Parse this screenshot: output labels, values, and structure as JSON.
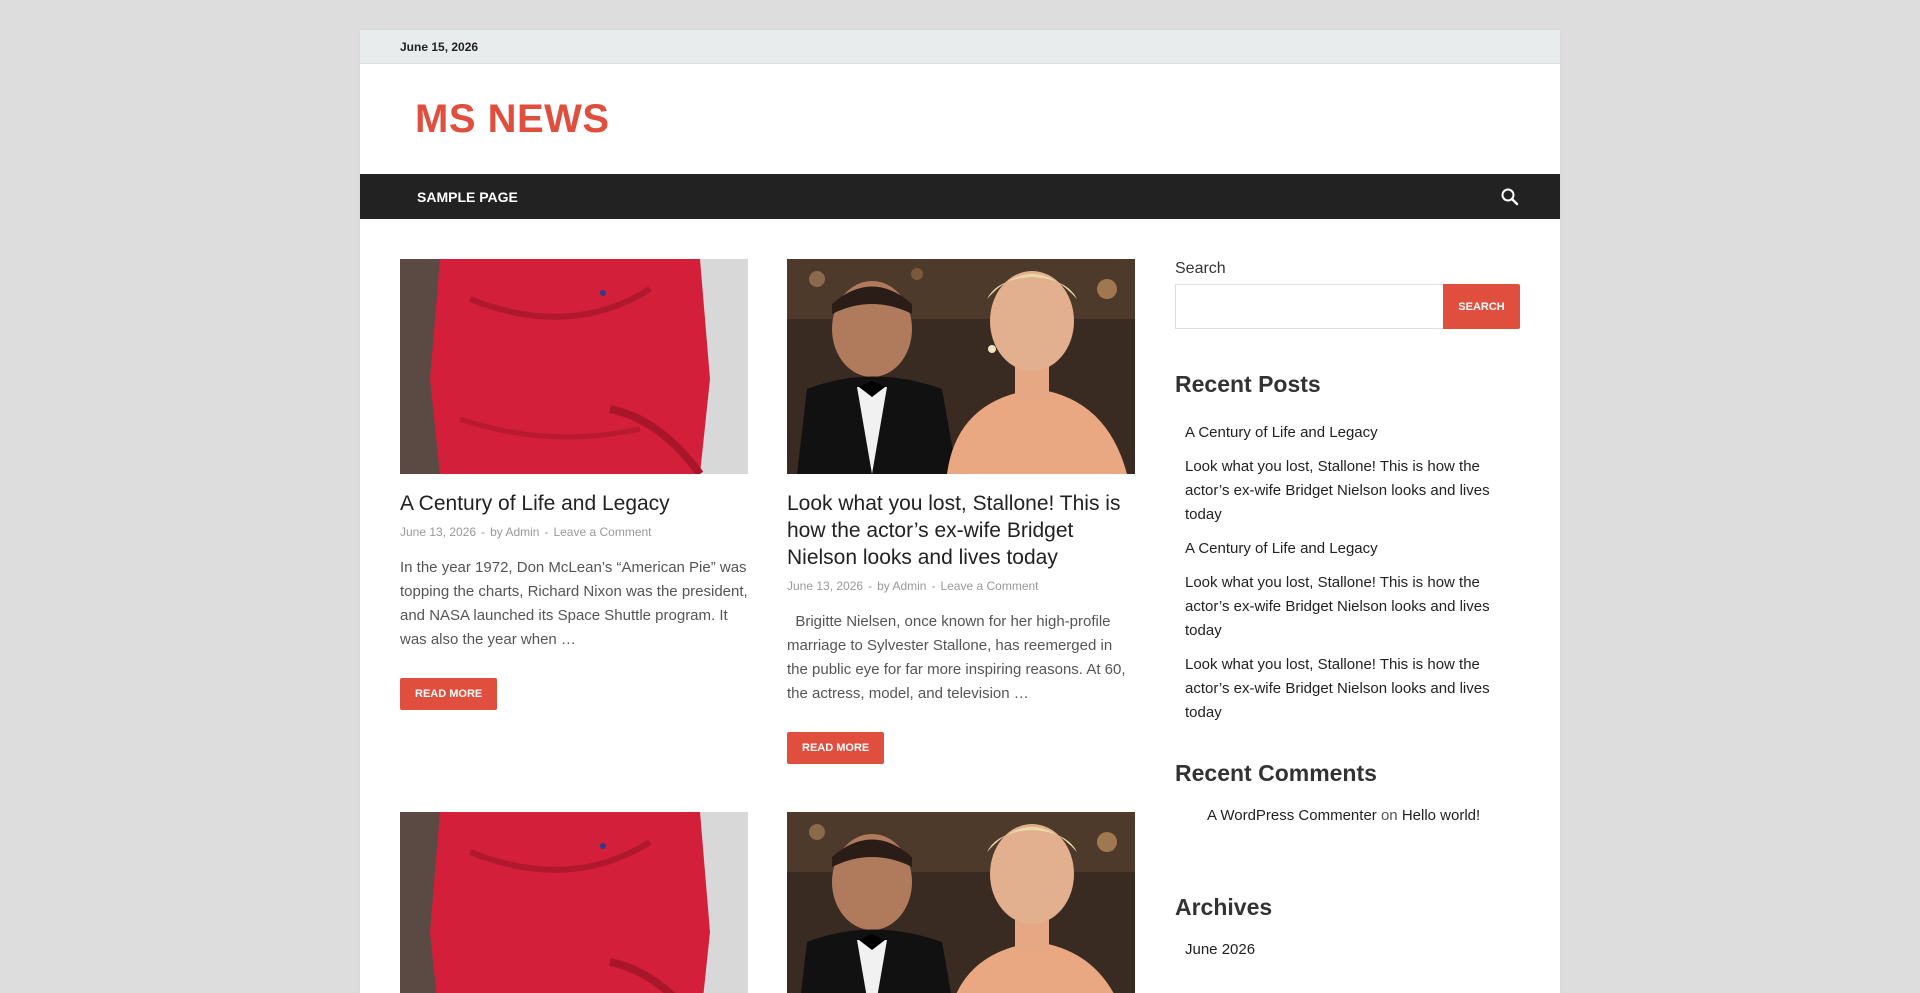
{
  "topbar": {
    "date": "June 15, 2026"
  },
  "header": {
    "site_title": "MS NEWS"
  },
  "nav": {
    "items": [
      {
        "label": "SAMPLE PAGE"
      }
    ]
  },
  "posts": [
    {
      "title": "A Century of Life and Legacy",
      "date": "June 13, 2026",
      "by": "by",
      "author": "Admin",
      "comments_link": "Leave a Comment",
      "excerpt": "In the year 1972, Don McLean’s “American Pie” was topping the charts, Richard Nixon was the president, and NASA launched its Space Shuttle program. It was also the year when …",
      "read_more": "READ MORE",
      "thumb_icon": "red-sweater-photo"
    },
    {
      "title": "Look what you lost, Stallone! This is how the actor’s ex-wife Bridget Nielson looks and lives today",
      "date": "June 13, 2026",
      "by": "by",
      "author": "Admin",
      "comments_link": "Leave a Comment",
      "excerpt": "  Brigitte Nielsen, once known for her high-profile marriage to Sylvester Stallone, has reemerged in the public eye for far more inspiring reasons. At 60, the actress, model, and television …",
      "read_more": "READ MORE",
      "thumb_icon": "couple-photo"
    }
  ],
  "sidebar": {
    "search_label": "Search",
    "search_button": "SEARCH",
    "recent_posts_title": "Recent Posts",
    "recent_posts": [
      "A Century of Life and Legacy",
      "Look what you lost, Stallone! This is how the actor’s ex-wife Bridget Nielson looks and lives today",
      "A Century of Life and Legacy",
      "Look what you lost, Stallone! This is how the actor’s ex-wife Bridget Nielson looks and lives today",
      "Look what you lost, Stallone! This is how the actor’s ex-wife Bridget Nielson looks and lives today"
    ],
    "recent_comments_title": "Recent Comments",
    "recent_comment": {
      "author": "A WordPress Commenter",
      "on": "on",
      "post": "Hello world!"
    },
    "archives_title": "Archives",
    "archives": [
      "June 2026"
    ]
  },
  "colors": {
    "accent": "#e04e3d",
    "nav_bg": "#222222",
    "page_bg": "#dddddd"
  }
}
